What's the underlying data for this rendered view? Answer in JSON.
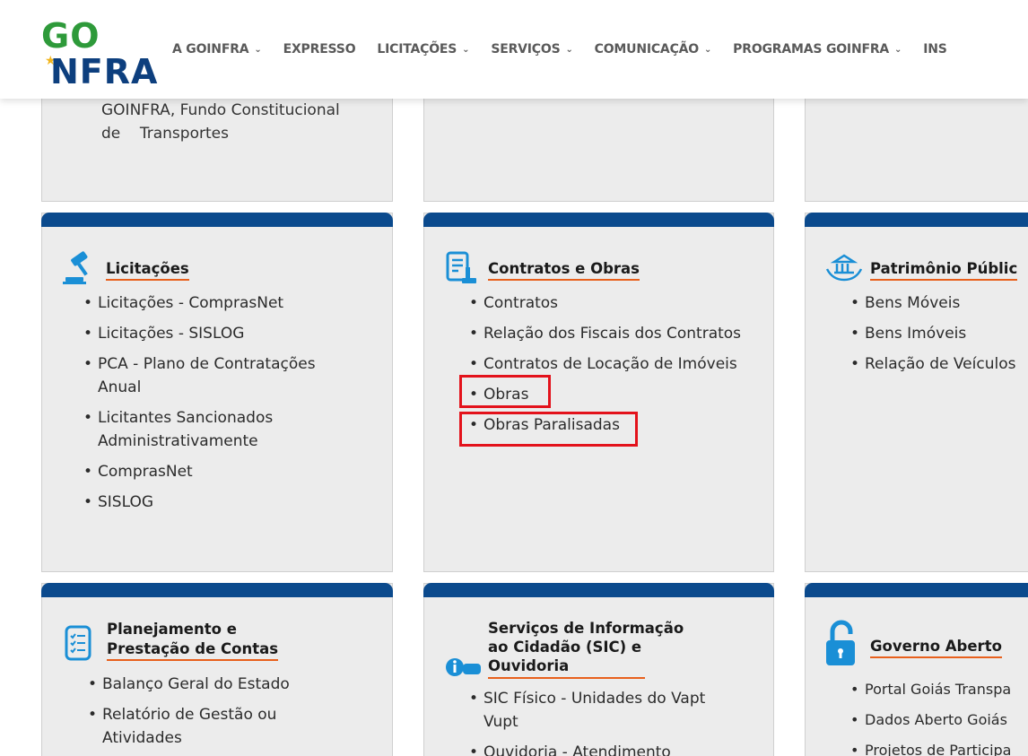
{
  "header": {
    "logo_top": "GO",
    "logo_bottom": "NFRA",
    "nav": [
      {
        "label": "A GOINFRA",
        "has_dropdown": true
      },
      {
        "label": "EXPRESSO",
        "has_dropdown": false
      },
      {
        "label": "LICITAÇÕES",
        "has_dropdown": true
      },
      {
        "label": "SERVIÇOS",
        "has_dropdown": true
      },
      {
        "label": "COMUNICAÇÃO",
        "has_dropdown": true
      },
      {
        "label": "PROGRAMAS GOINFRA",
        "has_dropdown": true
      },
      {
        "label": "INS",
        "has_dropdown": false
      }
    ]
  },
  "top_row": {
    "fragment_line1": "GOINFRA, Fundo Constitucional",
    "fragment_line2": "de    Transportes"
  },
  "cards": {
    "licitacoes": {
      "title": "Licitações",
      "icon": "gavel-icon",
      "items": [
        "Licitações - ComprasNet",
        "Licitações - SISLOG",
        "PCA - Plano de Contratações Anual",
        "Licitantes Sancionados Administrativamente",
        "ComprasNet",
        "SISLOG"
      ]
    },
    "contratos": {
      "title": "Contratos e Obras",
      "icon": "contract-document-icon",
      "items": [
        "Contratos",
        "Relação dos Fiscais dos Contratos",
        "Contratos de Locação de Imóveis",
        "Obras",
        "Obras Paralisadas"
      ],
      "highlighted": [
        "Obras",
        "Obras Paralisadas"
      ]
    },
    "patrimonio": {
      "title": "Patrimônio Públic",
      "icon": "public-building-icon",
      "items": [
        "Bens Móveis",
        "Bens Imóveis",
        "Relação de Veículos"
      ]
    },
    "planejamento": {
      "title_line1": "Planejamento e",
      "title_line2": "Prestação de Contas",
      "icon": "checklist-icon",
      "items": [
        "Balanço Geral do Estado",
        "Relatório de Gestão ou Atividades"
      ]
    },
    "sic": {
      "title_line1": "Serviços de Informação",
      "title_line2": "ao Cidadão (SIC) e",
      "title_line3": "Ouvidoria",
      "icon": "info-chat-icon",
      "items": [
        "SIC Físico - Unidades do Vapt Vupt",
        "Ouvidoria - Atendimento"
      ]
    },
    "governo": {
      "title": "Governo Aberto",
      "icon": "open-padlock-icon",
      "items": [
        "Portal Goiás Transpa",
        "Dados Aberto Goiás",
        "Projetos de Participa"
      ]
    }
  },
  "colors": {
    "navy": "#0b4a8d",
    "orange_underline": "#e8601c",
    "highlight_red": "#e3121b",
    "icon_blue": "#1a8fd6"
  }
}
